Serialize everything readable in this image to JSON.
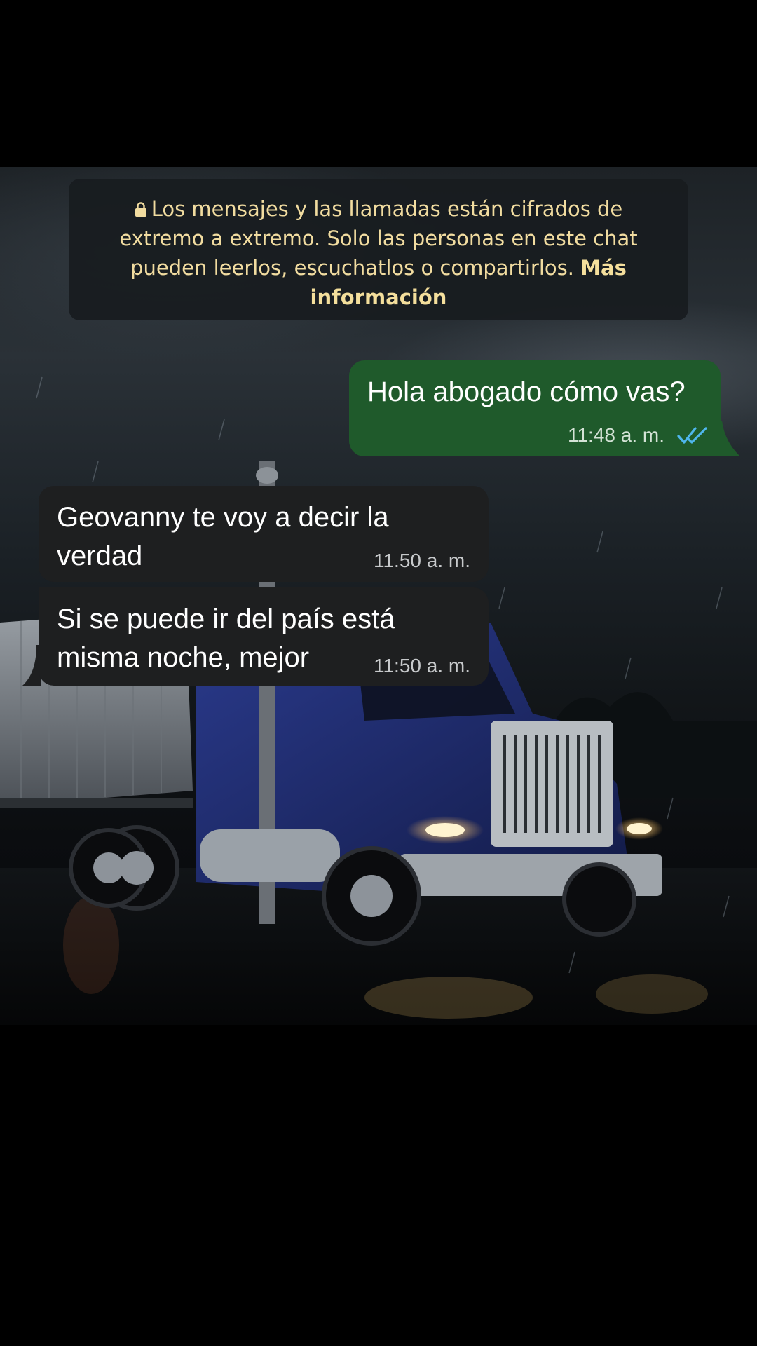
{
  "encryption_notice": {
    "text": "Los mensajes y las llamadas están cifrados de extremo a extremo. Solo las personas en este chat pueden leerlos, escuchatlos o compartirlos.",
    "link": "Más información",
    "icon": "lock-icon"
  },
  "messages": [
    {
      "direction": "outgoing",
      "text": "Hola abogado cómo vas?",
      "time": "11:48 a. m.",
      "status_icon": "double-check-read-icon",
      "read_color": "#4fb6ec"
    },
    {
      "direction": "incoming",
      "text": "Geovanny te voy a decir la verdad",
      "time": "11.50 a. m."
    },
    {
      "direction": "incoming",
      "text": "Si se puede ir del país está\nmisma noche, mejor",
      "time": "11:50 a. m."
    }
  ],
  "colors": {
    "outgoing_bubble": "#1f5a2b",
    "incoming_bubble": "#1e1f20",
    "notice_text": "#f1dca0"
  }
}
